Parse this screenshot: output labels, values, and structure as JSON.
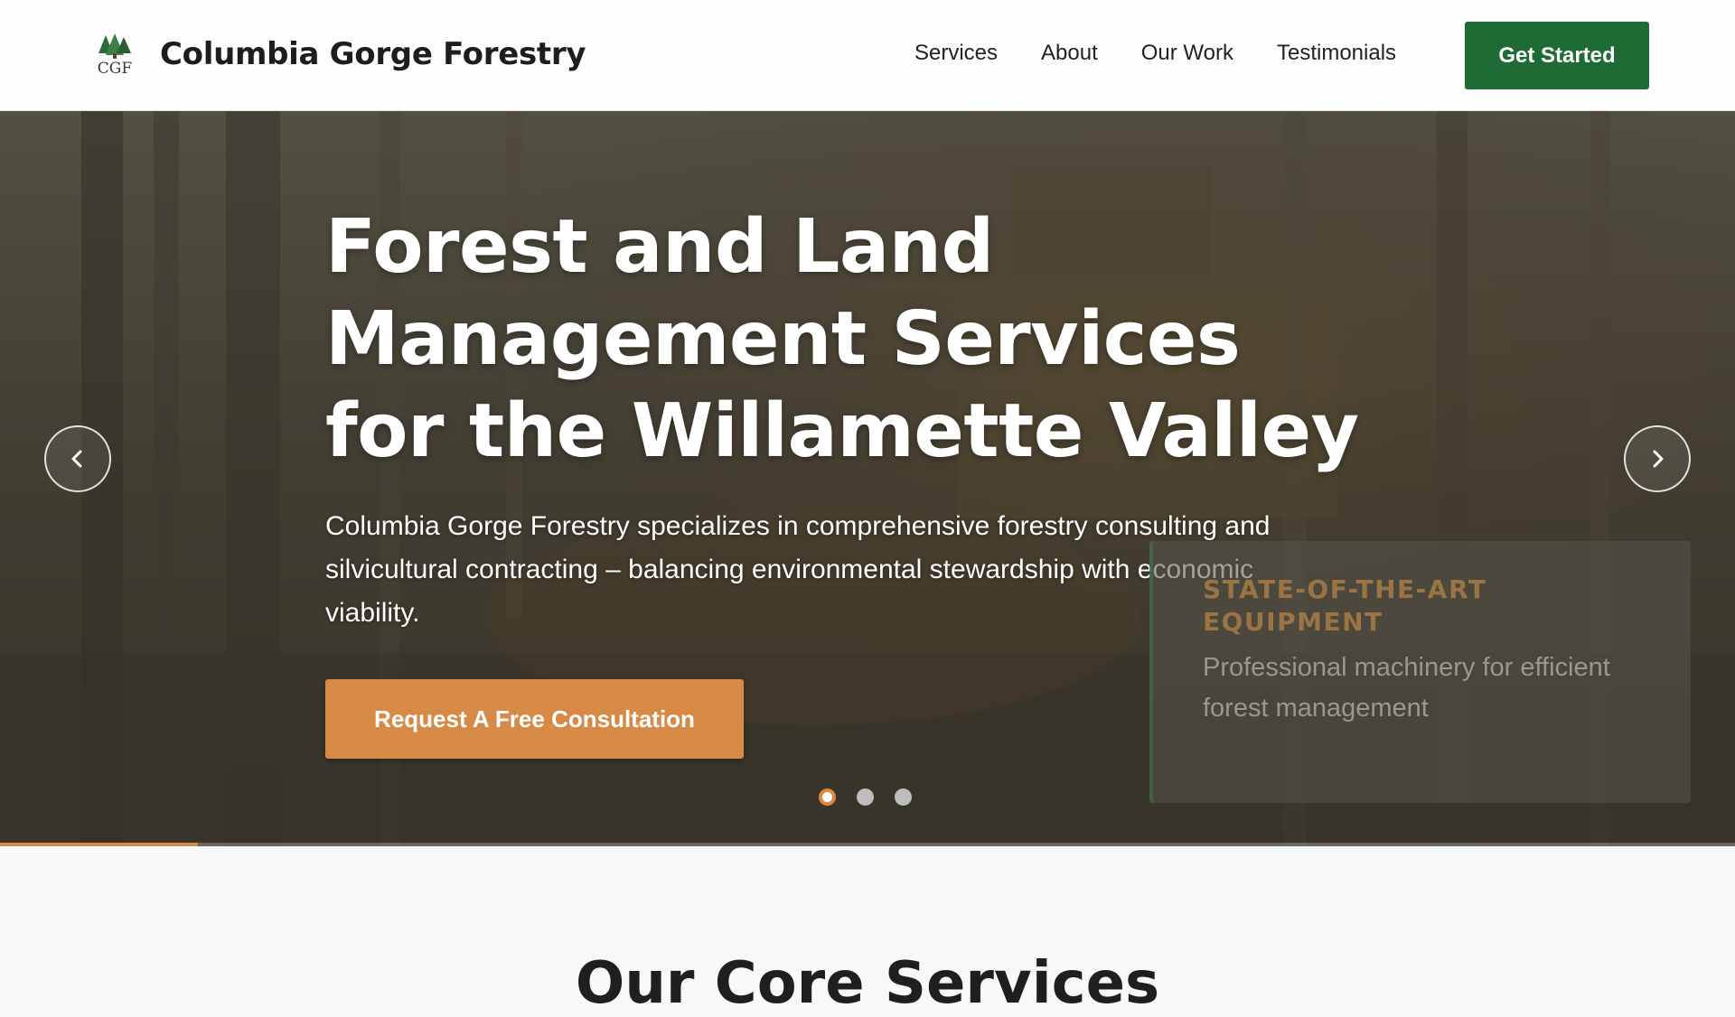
{
  "header": {
    "brand_name": "Columbia Gorge Forestry",
    "logo_text": "CGF",
    "nav": [
      {
        "label": "Services"
      },
      {
        "label": "About"
      },
      {
        "label": "Our Work"
      },
      {
        "label": "Testimonials"
      }
    ],
    "cta_label": "Get Started"
  },
  "hero": {
    "title": "Forest and Land Management Services for the Willamette Valley",
    "description": "Columbia Gorge Forestry specializes in comprehensive forestry consulting and silvicultural contracting – balancing environmental stewardship with economic viability.",
    "cta_label": "Request A Free Consultation",
    "feature_card": {
      "title": "STATE-OF-THE-ART EQUIPMENT",
      "description": "Professional machinery for efficient forest management"
    },
    "slides": {
      "count": 3,
      "active_index": 0
    },
    "progress_fraction": 0.114
  },
  "section": {
    "heading": "Our Core Services"
  },
  "colors": {
    "primary_green": "#1f6b35",
    "accent_orange": "#d78a45"
  },
  "icons": [
    "logo-tree-icon",
    "chevron-left-icon",
    "chevron-right-icon"
  ]
}
